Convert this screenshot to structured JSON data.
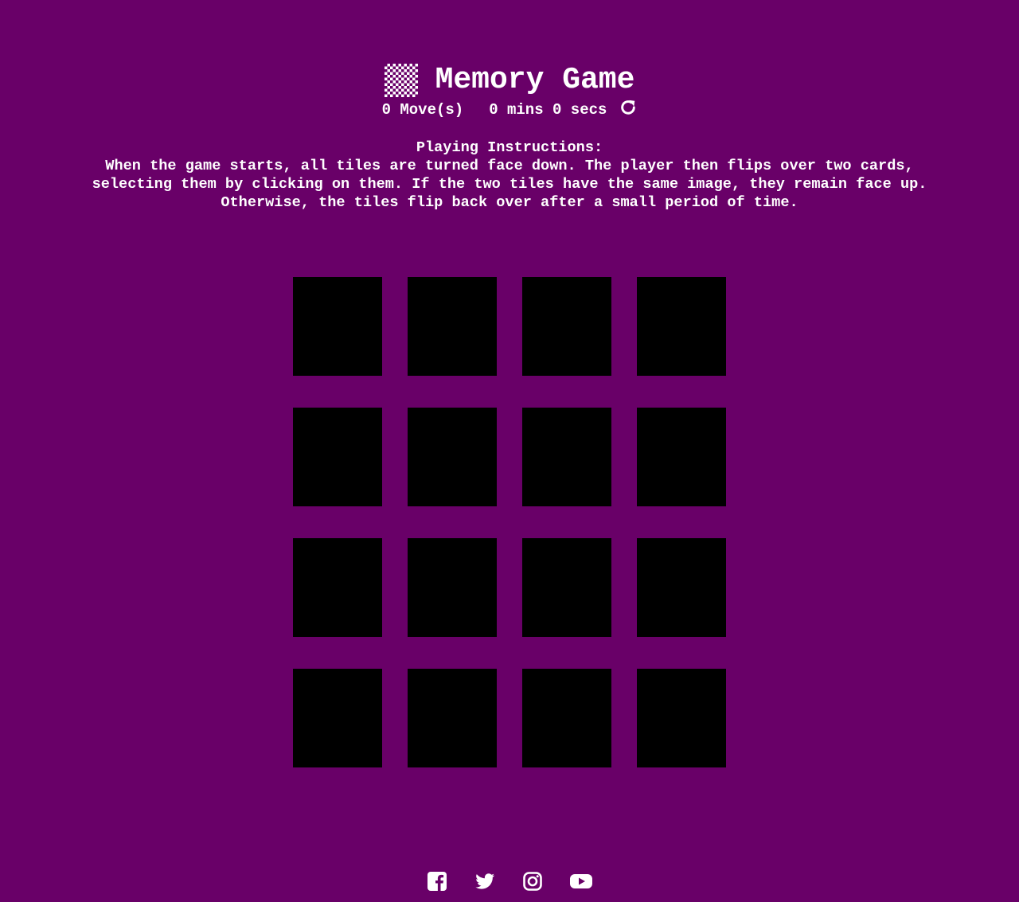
{
  "header": {
    "title": "Memory Game",
    "logo_icon": "checkerboard-icon"
  },
  "stats": {
    "moves": "0 Move(s)",
    "timer": "0 mins 0 secs",
    "restart_icon": "redo-icon"
  },
  "instructions": {
    "heading": "Playing Instructions:",
    "line1": "When the game starts, all tiles are turned face down. The player then flips over two cards,",
    "line2": "selecting them by clicking on them. If the two tiles have the same image, they remain face up.",
    "line3": "Otherwise, the tiles flip back over after a small period of time."
  },
  "board": {
    "rows": 4,
    "columns": 4,
    "card_color": "#000000",
    "face_down_cards": 16
  },
  "footer": {
    "social_icons": [
      "facebook-icon",
      "twitter-icon",
      "instagram-icon",
      "youtube-icon"
    ]
  },
  "colors": {
    "background": "#690068",
    "text": "#ffffff",
    "card": "#000000"
  }
}
